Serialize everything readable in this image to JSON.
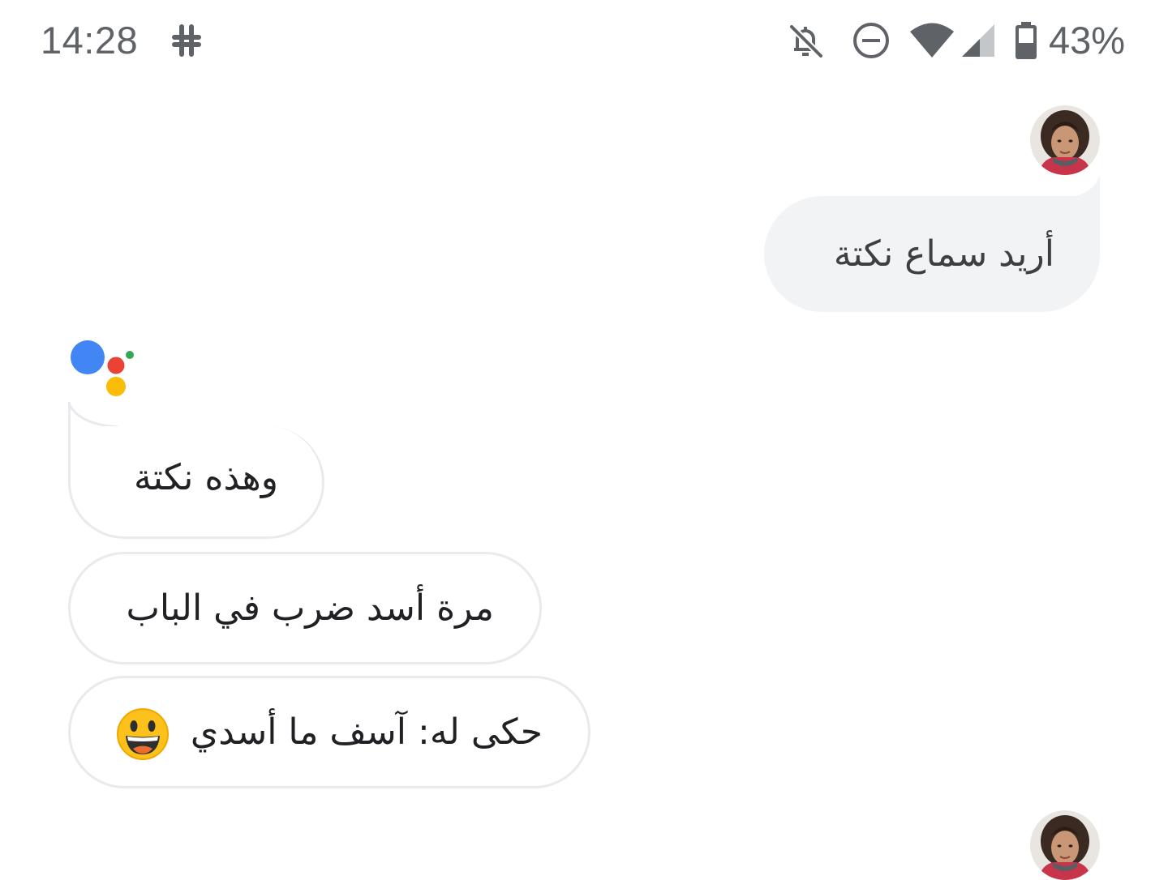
{
  "status_bar": {
    "time": "14:28",
    "battery_percent": "43%",
    "icons": [
      "slack-icon",
      "bell-off-icon",
      "do-not-disturb-icon",
      "wifi-icon",
      "cell-signal-icon",
      "battery-icon"
    ],
    "icon_color": "#5f6368"
  },
  "conversation": {
    "user_message": "أريد سماع نكتة",
    "assistant_messages": [
      {
        "text": "وهذه نكتة"
      },
      {
        "text": "مرة أسد ضرب في الباب"
      },
      {
        "text": "حكى له: آسف ما أسدي",
        "emoji": "smiling-face-icon"
      }
    ]
  },
  "colors": {
    "user_bubble": "#f1f3f4",
    "bot_bubble_border": "#e8eaed",
    "assistant_blue": "#4285f4",
    "assistant_red": "#ea4335",
    "assistant_yellow": "#fbbc05",
    "assistant_green": "#34a853"
  }
}
